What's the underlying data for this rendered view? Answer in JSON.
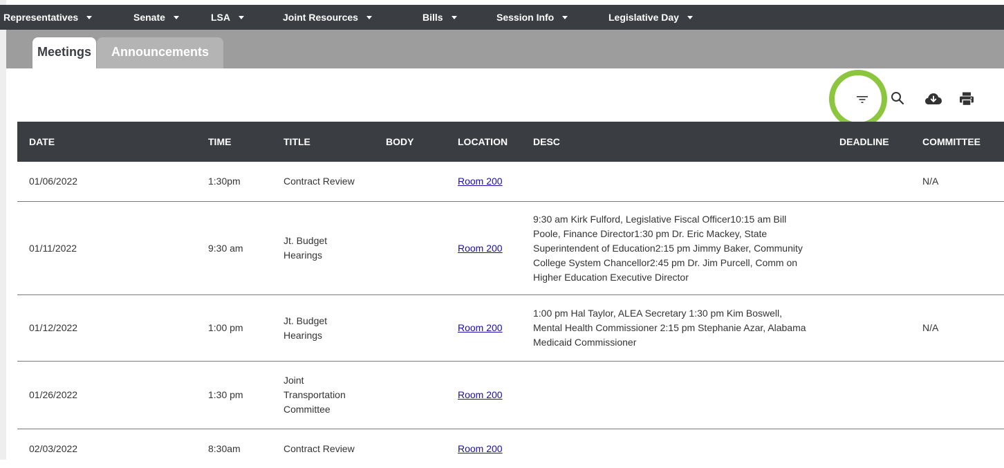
{
  "nav": [
    {
      "label": "Representatives"
    },
    {
      "label": "Senate"
    },
    {
      "label": "LSA"
    },
    {
      "label": "Joint Resources"
    },
    {
      "label": "Bills"
    },
    {
      "label": "Session Info"
    },
    {
      "label": "Legislative Day"
    }
  ],
  "tabs": {
    "meetings": "Meetings",
    "announcements": "Announcements"
  },
  "toolbar": {
    "icons": [
      "filter-icon",
      "search-icon",
      "cloud-download-icon",
      "print-icon"
    ],
    "highlight_color": "#8cc63f"
  },
  "table": {
    "headers": {
      "date": "DATE",
      "time": "TIME",
      "title": "TITLE",
      "body": "BODY",
      "location": "LOCATION",
      "desc": "DESC",
      "deadline": "DEADLINE",
      "committee": "COMMITTEE"
    },
    "rows": [
      {
        "date": "01/06/2022",
        "time": "1:30pm",
        "title": "Contract Review",
        "body": "",
        "location": "Room 200",
        "desc": "",
        "deadline": "",
        "committee": "N/A"
      },
      {
        "date": "01/11/2022",
        "time": "9:30 am",
        "title": "Jt. Budget Hearings",
        "body": "",
        "location": "Room 200",
        "desc": "9:30 am Kirk Fulford, Legislative Fiscal Officer10:15 am Bill Poole, Finance Director1:30 pm Dr. Eric Mackey, State Superintendent of Education2:15 pm Jimmy Baker, Community College System Chancellor2:45 pm Dr. Jim Purcell, Comm on Higher Education Executive Director",
        "deadline": "",
        "committee": ""
      },
      {
        "date": "01/12/2022",
        "time": "1:00 pm",
        "title": "Jt. Budget Hearings",
        "body": "",
        "location": "Room 200",
        "desc": "1:00 pm Hal Taylor, ALEA Secretary 1:30 pm Kim Boswell, Mental Health Commissioner 2:15 pm Stephanie Azar, Alabama Medicaid Commissioner",
        "deadline": "",
        "committee": "N/A"
      },
      {
        "date": "01/26/2022",
        "time": "1:30 pm",
        "title": "Joint Transportation Committee",
        "body": "",
        "location": "Room 200",
        "desc": "",
        "deadline": "",
        "committee": ""
      },
      {
        "date": "02/03/2022",
        "time": "8:30am",
        "title": "Contract Review",
        "body": "",
        "location": "Room 200",
        "desc": "",
        "deadline": "",
        "committee": ""
      }
    ]
  },
  "colors": {
    "nav_bg": "#3a3d42",
    "tabbar_bg": "#9d9d9d",
    "link": "#1a0dab"
  }
}
